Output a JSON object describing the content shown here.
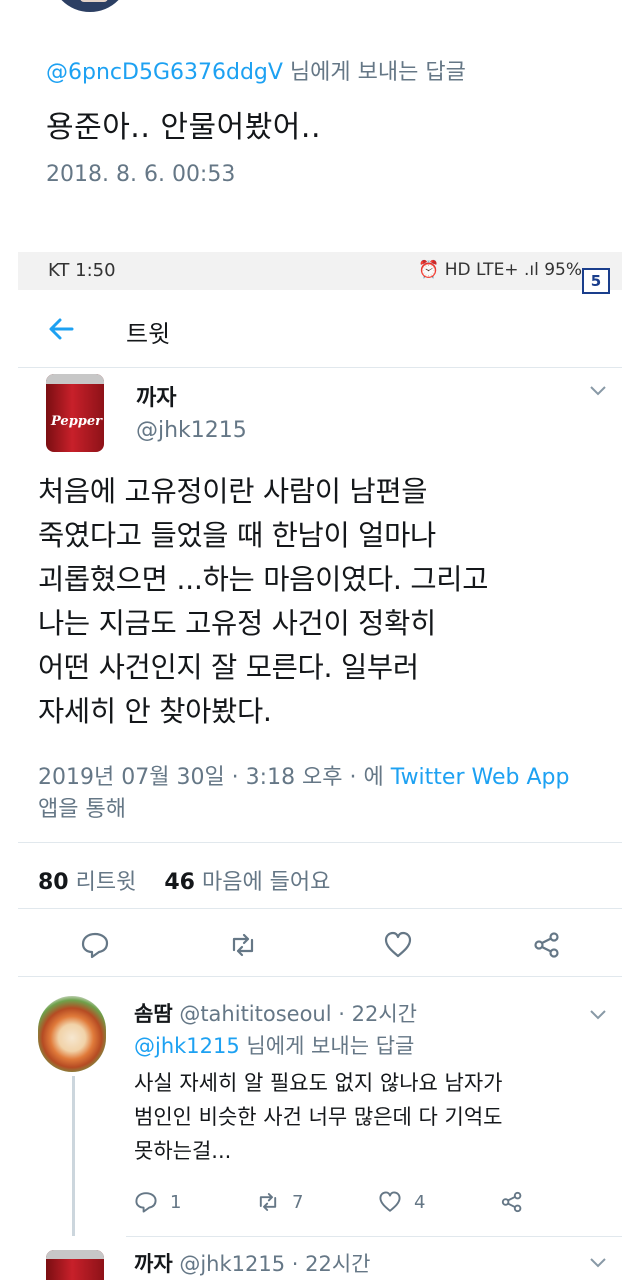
{
  "previous_tweet": {
    "reply_handle": "@6pncD5G6376ddgV",
    "reply_suffix": " 님에게 보내는 답글",
    "text": "용준아.. 안물어봤어..",
    "timestamp": "2018. 8. 6. 00:53"
  },
  "status_bar": {
    "carrier_time": "KT 1:50",
    "indicators": "⏰ HD LTE+ .ıl 95%"
  },
  "badge": "5",
  "header": {
    "back_icon": "back-arrow-icon",
    "title": "트윗"
  },
  "tweet": {
    "author_name": "까자",
    "author_handle": "@jhk1215",
    "avatar_label": "Pepper",
    "lines": [
      "처음에 고유정이란 사람이 남편을",
      "죽였다고 들었을 때 한남이 얼마나",
      "괴롭혔으면 ...하는 마음이였다. 그리고",
      "나는 지금도 고유정 사건이 정확히",
      "어떤 사건인지 잘 모른다. 일부러",
      "자세히 안 찾아봤다."
    ],
    "datetime": "2019년 07월 30일 · 3:18 오후 · 에 ",
    "via": "Twitter Web App",
    "via_suffix": "앱을 통해",
    "retweets_count": "80",
    "retweets_label": "리트윗",
    "likes_count": "46",
    "likes_label": "마음에 들어요",
    "colors": {
      "accent": "#1da1f2",
      "secondary": "#657786",
      "text": "#14171a"
    }
  },
  "reply": {
    "author_name": "솜땀",
    "author_handle": "@tahititoseoul",
    "time": "· 22시간",
    "reply_handle": "@jhk1215",
    "reply_suffix": " 님에게 보내는 답글",
    "lines": [
      "사실 자세히 알 필요도 없지 않나요 남자가",
      "범인인 비슷한 사건 너무 많은데 다 기억도",
      "못하는걸..."
    ],
    "reply_count": "1",
    "retweet_count": "7",
    "like_count": "4"
  },
  "next_reply": {
    "author_name": "까자",
    "author_handle": "@jhk1215",
    "time": "· 22시간"
  }
}
